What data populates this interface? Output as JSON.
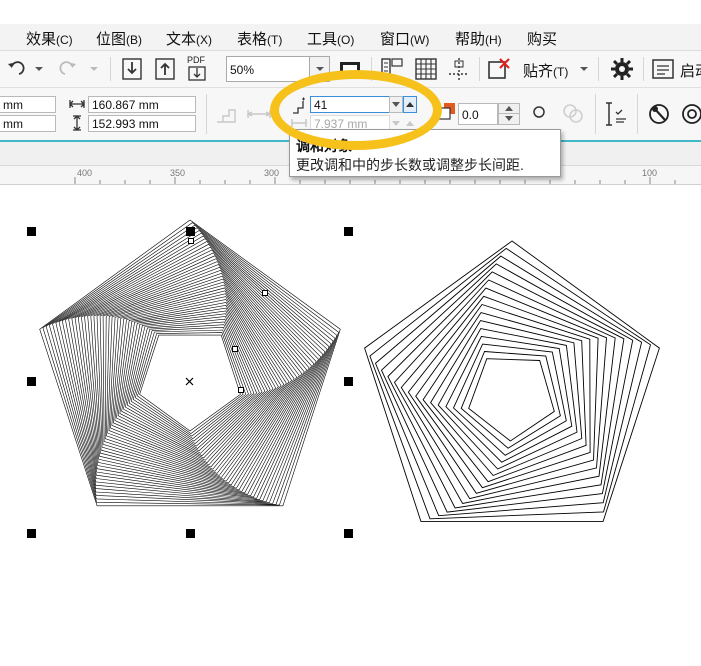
{
  "menu": {
    "items": [
      {
        "label": "效果",
        "hotkey": "(C)"
      },
      {
        "label": "位图",
        "hotkey": "(B)"
      },
      {
        "label": "文本",
        "hotkey": "(X)"
      },
      {
        "label": "表格",
        "hotkey": "(T)"
      },
      {
        "label": "工具",
        "hotkey": "(O)"
      },
      {
        "label": "窗口",
        "hotkey": "(W)"
      },
      {
        "label": "帮助",
        "hotkey": "(H)"
      },
      {
        "label": "购买",
        "hotkey": ""
      }
    ]
  },
  "toolbar": {
    "zoom": "50%",
    "pdf_label": "PDF",
    "snap_label": "贴齐",
    "snap_hotkey": "(T)",
    "launch_label": "启动"
  },
  "properties": {
    "x_value": "mm",
    "y_value": "mm",
    "width_value": "160.867 mm",
    "height_value": "152.993 mm",
    "steps_value": "41",
    "spacing_value": "7.937 mm",
    "angle_value": "0.0"
  },
  "ruler": {
    "labels": [
      "400",
      "350",
      "300",
      "100"
    ]
  },
  "tooltip": {
    "title": "调和对象",
    "description": "更改调和中的步长数或调整步长间距."
  },
  "colors": {
    "highlight": "#f5c11a",
    "ruler_line": "#3fb8c8"
  }
}
